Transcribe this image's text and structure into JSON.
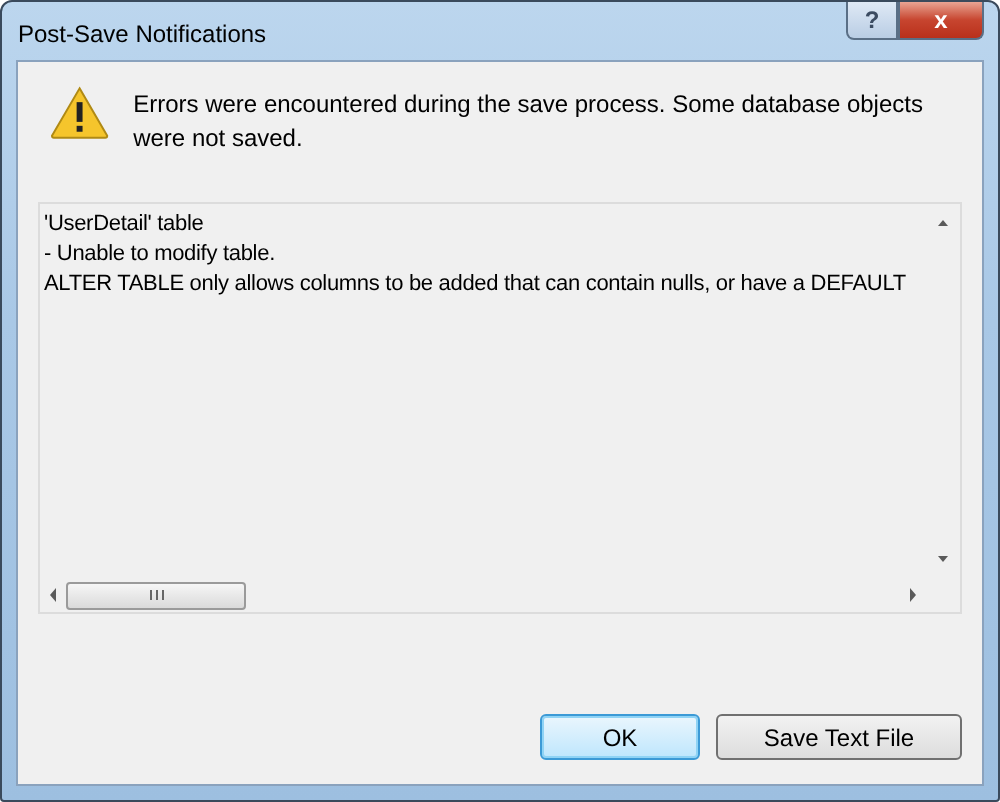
{
  "window": {
    "title": "Post-Save Notifications"
  },
  "title_buttons": [
    {
      "kind": "help",
      "label": "?"
    },
    {
      "kind": "close",
      "label": "x"
    }
  ],
  "message": "Errors were encountered during the save process. Some database objects were not saved.",
  "details": [
    "'UserDetail' table",
    "- Unable to modify table.",
    "ALTER TABLE only allows columns to be added that can contain nulls, or have a DEFAULT"
  ],
  "buttons": [
    {
      "label": "OK",
      "default": true
    },
    {
      "label": "Save Text File",
      "default": false
    }
  ]
}
